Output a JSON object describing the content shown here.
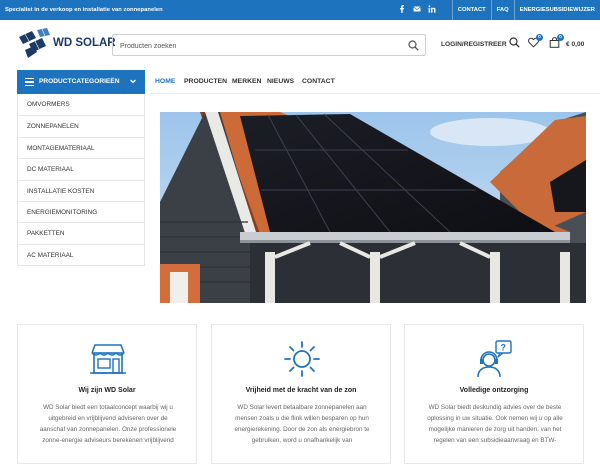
{
  "topbar": {
    "promo": "Specialist in de verkoop en installatie van zonnepanelen",
    "social": [
      "facebook-icon",
      "mail-icon",
      "linkedin-icon"
    ],
    "links": [
      "CONTACT",
      "FAQ",
      "ENERGIESUBSIDIEWIJZER"
    ]
  },
  "header": {
    "logo_text": "WD SOLAR",
    "search_placeholder": "Producten zoeken",
    "login": "LOGIN/REGISTREER",
    "wishlist_count": "0",
    "cart_count": "0",
    "cart_total": "€ 0,00"
  },
  "categories": {
    "title": "PRODUCTCATEGORIEËN",
    "items": [
      "OMVORMERS",
      "ZONNEPANELEN",
      "MONTAGEMATERIAAL",
      "DC MATERIAAL",
      "INSTALLATIE KOSTEN",
      "ENERGIEMONITORING",
      "PAKKETTEN",
      "AC MATERIAAL"
    ]
  },
  "nav": [
    "HOME",
    "PRODUCTEN",
    "MERKEN",
    "NIEUWS",
    "CONTACT"
  ],
  "features": [
    {
      "icon": "shop-icon",
      "title": "Wij zijn WD Solar",
      "text": [
        "WD Solar biedt een totaalconcept waarbij wij u",
        "uitgebreid en vrijblijvend adviseren over de",
        "aanschaf van zonnepanelen. Onze professionele",
        "zonne-energie adviseurs berekenen vrijblijvend"
      ]
    },
    {
      "icon": "sun-icon",
      "title": "Vrijheid met de kracht van de zon",
      "text": [
        "WD Solar levert betaalbare zonnepanelen aan",
        "mensen zoals u die flink willen besparen op hun",
        "energierekening. Door de zon als energiebron te",
        "gebruiken, word u onafhankelijk van"
      ]
    },
    {
      "icon": "support-icon",
      "title": "Volledige ontzorging",
      "text": [
        "WD Solar biedt deskundig advies over de beste",
        "oplossing in uw situatie. Ook nemen wij u op alle",
        "mogelijke manieren de zorg uit handen: van het",
        "regelen van een subsidieaanvraag en BTW-"
      ]
    }
  ],
  "colors": {
    "brand_blue": "#1e73be",
    "logo_navy": "#1c3a66"
  }
}
